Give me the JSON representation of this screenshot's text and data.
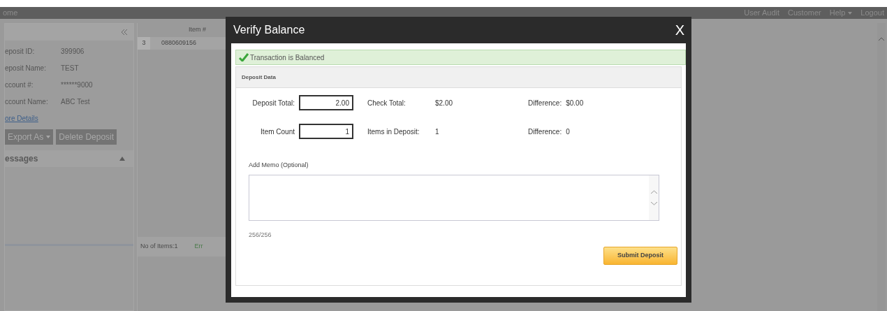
{
  "nav": {
    "title": "ome",
    "links": [
      {
        "label": "User Audit",
        "dropdown": false
      },
      {
        "label": "Customer",
        "dropdown": false
      },
      {
        "label": "Help",
        "dropdown": true
      },
      {
        "label": "Logout",
        "dropdown": false
      }
    ]
  },
  "deposit_panel": {
    "fields": [
      {
        "label": "eposit ID:",
        "value": "399906"
      },
      {
        "label": "eposit Name:",
        "value": "TEST"
      },
      {
        "label": "ccount #:",
        "value": "******9000"
      },
      {
        "label": "ccount Name:",
        "value": "ABC Test"
      }
    ],
    "link": "ore Details",
    "buttons": [
      {
        "label": "Export As",
        "dropdown": true
      },
      {
        "label": "Delete Deposit",
        "dropdown": false
      }
    ],
    "messages_header": "essages"
  },
  "grid": {
    "column": "Item #",
    "rows": [
      {
        "row_number": "3",
        "item": "0880609156"
      }
    ],
    "footer": "No of Items:1",
    "status": "Err"
  },
  "dialog": {
    "title": "Verify Balance",
    "close": "X",
    "banner": "Transaction is Balanced",
    "section_title": "Deposit Data",
    "rows": [
      {
        "input_label": "Deposit Total:",
        "input_value": "2.00",
        "label": "Check Total:",
        "value": "$2.00",
        "diff_label": "Difference:",
        "diff_value": "$0.00"
      },
      {
        "input_label": "Item Count",
        "input_value": "1",
        "label": "Items in Deposit:",
        "value": "1",
        "diff_label": "Difference:",
        "diff_value": "0"
      }
    ],
    "memo_label": "Add Memo (Optional)",
    "counter": "256/256",
    "submit": "Submit Deposit"
  }
}
